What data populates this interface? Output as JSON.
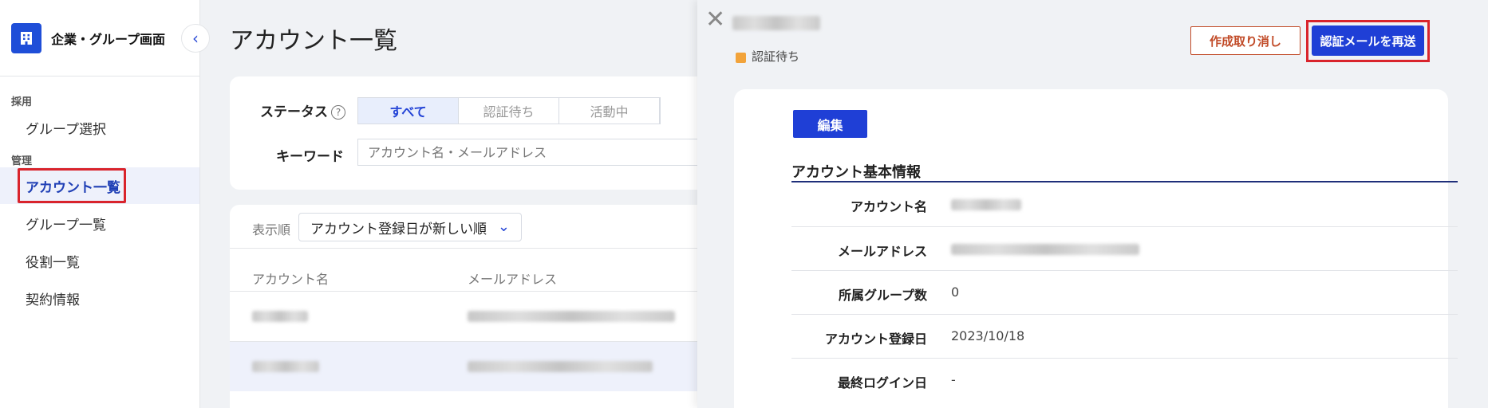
{
  "sidebar": {
    "brand_title": "企業・グループ画面",
    "sections": [
      {
        "label": "採用",
        "items": [
          {
            "label": "グループ選択"
          }
        ]
      },
      {
        "label": "管理",
        "items": [
          {
            "label": "アカウント一覧",
            "active": true
          },
          {
            "label": "グループ一覧"
          },
          {
            "label": "役割一覧"
          },
          {
            "label": "契約情報"
          }
        ]
      }
    ],
    "collapse_icon": "chevron-left-icon"
  },
  "main": {
    "title": "アカウント一覧",
    "filter": {
      "status_label": "ステータス",
      "status_options": [
        "すべて",
        "認証待ち",
        "活動中"
      ],
      "status_selected": "すべて",
      "keyword_label": "キーワード",
      "keyword_placeholder": "アカウント名・メールアドレス"
    },
    "list": {
      "sort_label": "表示順",
      "sort_value": "アカウント登録日が新しい順",
      "columns": [
        "アカウント名",
        "メールアドレス"
      ]
    }
  },
  "drawer": {
    "status": "認証待ち",
    "status_color": "#f2a33a",
    "cancel_button": "作成取り消し",
    "resend_button": "認証メールを再送",
    "edit_button": "編集",
    "section_title": "アカウント基本情報",
    "fields": [
      {
        "label": "アカウント名",
        "value": ""
      },
      {
        "label": "メールアドレス",
        "value": ""
      },
      {
        "label": "所属グループ数",
        "value": "0"
      },
      {
        "label": "アカウント登録日",
        "value": "2023/10/18"
      },
      {
        "label": "最終ログイン日",
        "value": "-"
      }
    ]
  },
  "colors": {
    "accent": "#1f3fd6",
    "highlight_box": "#d9242c",
    "cancel": "#c14b28"
  }
}
